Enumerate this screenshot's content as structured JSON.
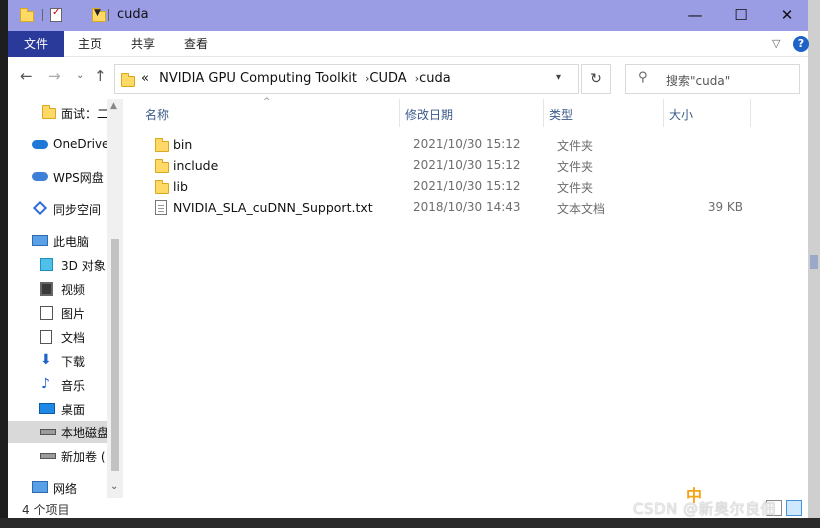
{
  "window": {
    "title": "cuda",
    "controls": {
      "minimize": "—",
      "maximize": "☐",
      "close": "✕"
    }
  },
  "ribbon": {
    "tabs": [
      "文件",
      "主页",
      "共享",
      "查看"
    ],
    "help": "?"
  },
  "address": {
    "overflow": "«",
    "crumbs": [
      "NVIDIA GPU Computing Toolkit",
      "CUDA",
      "cuda"
    ],
    "search_placeholder": "搜索\"cuda\""
  },
  "navpane": {
    "items": [
      {
        "label": "面试：二",
        "icon": "folder-icon"
      },
      {
        "label": "OneDrive",
        "icon": "cloud-icon"
      },
      {
        "label": "WPS网盘",
        "icon": "wps-cloud-icon"
      },
      {
        "label": "同步空间",
        "icon": "sync-icon"
      },
      {
        "label": "此电脑",
        "icon": "computer-icon"
      },
      {
        "label": "3D 对象",
        "icon": "3d-objects-icon"
      },
      {
        "label": "视频",
        "icon": "video-icon"
      },
      {
        "label": "图片",
        "icon": "pictures-icon"
      },
      {
        "label": "文档",
        "icon": "documents-icon"
      },
      {
        "label": "下载",
        "icon": "download-icon"
      },
      {
        "label": "音乐",
        "icon": "music-icon"
      },
      {
        "label": "桌面",
        "icon": "desktop-icon"
      },
      {
        "label": "本地磁盘",
        "icon": "local-disk-icon"
      },
      {
        "label": "新加卷 (",
        "icon": "drive-icon"
      },
      {
        "label": "网络",
        "icon": "network-icon"
      }
    ]
  },
  "columns": {
    "name": "名称",
    "date": "修改日期",
    "type": "类型",
    "size": "大小"
  },
  "files": [
    {
      "name": "bin",
      "date": "2021/10/30 15:12",
      "type": "文件夹",
      "size": "",
      "kind": "folder"
    },
    {
      "name": "include",
      "date": "2021/10/30 15:12",
      "type": "文件夹",
      "size": "",
      "kind": "folder"
    },
    {
      "name": "lib",
      "date": "2021/10/30 15:12",
      "type": "文件夹",
      "size": "",
      "kind": "folder"
    },
    {
      "name": "NVIDIA_SLA_cuDNN_Support.txt",
      "date": "2018/10/30 14:43",
      "type": "文本文档",
      "size": "39 KB",
      "kind": "text"
    }
  ],
  "status": {
    "item_count": "4 个项目"
  },
  "watermark": "CSDN @新奥尔良佃",
  "sticker": "中",
  "colors": {
    "titlebar": "#9a9de4",
    "file_tab": "#2a3a9a",
    "folder": "#ffd966",
    "help": "#1e63c8"
  }
}
